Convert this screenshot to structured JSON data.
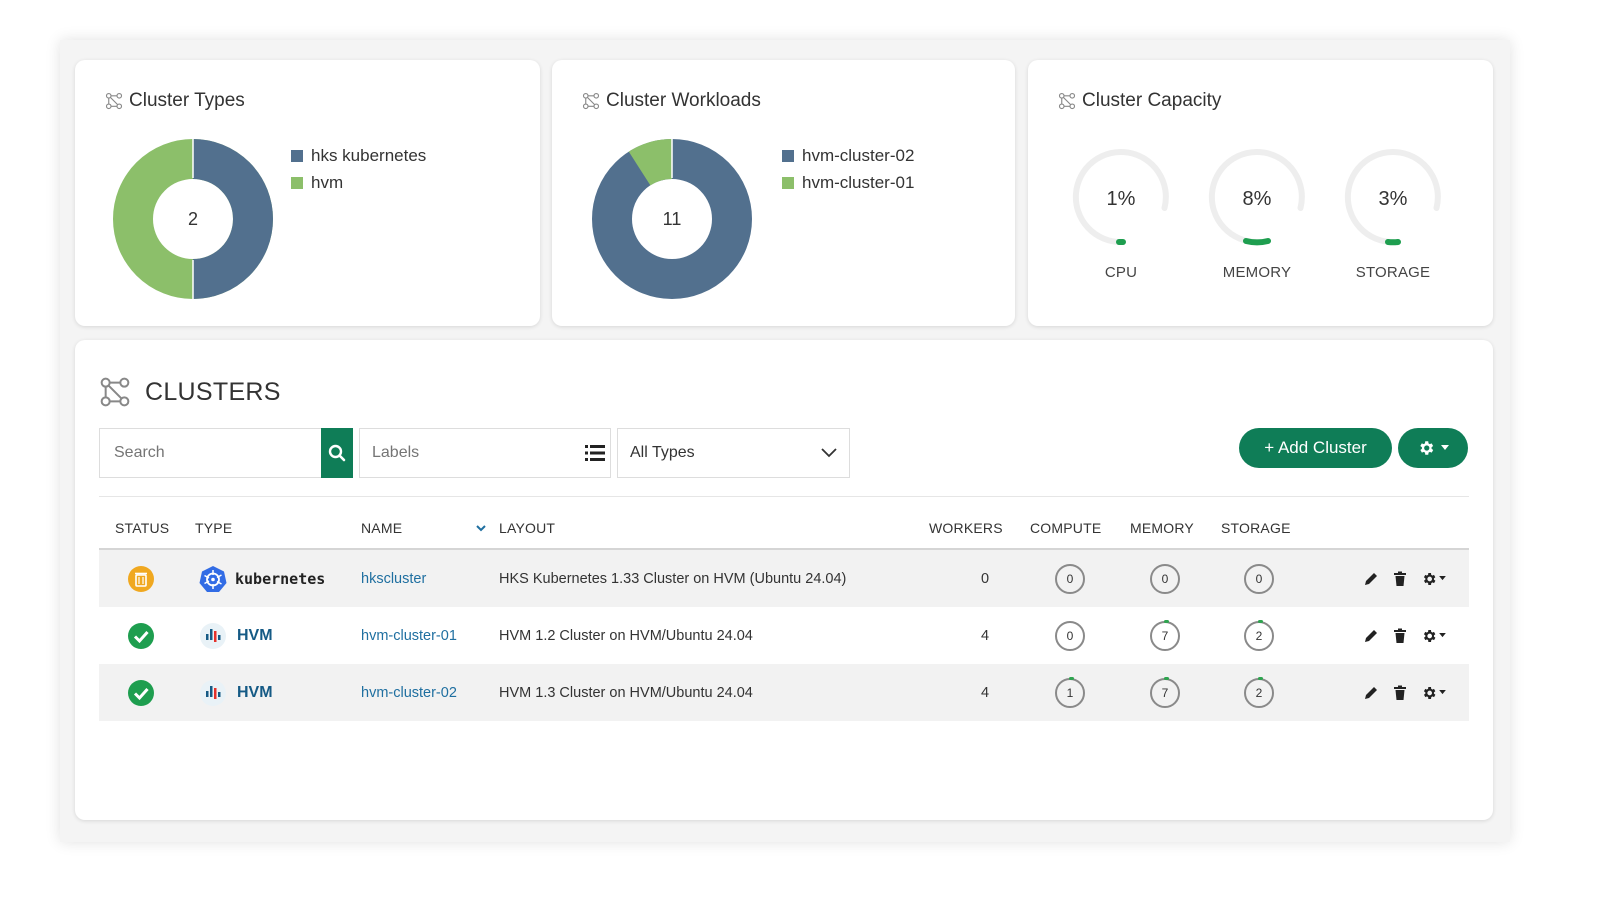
{
  "cards": {
    "types": {
      "title": "Cluster Types",
      "center_value": "2",
      "legend": [
        {
          "label": "hks kubernetes",
          "color": "#52708e"
        },
        {
          "label": "hvm",
          "color": "#8cbf6a"
        }
      ]
    },
    "workloads": {
      "title": "Cluster Workloads",
      "center_value": "11",
      "legend": [
        {
          "label": "hvm-cluster-02",
          "color": "#52708e"
        },
        {
          "label": "hvm-cluster-01",
          "color": "#8cbf6a"
        }
      ]
    },
    "capacity": {
      "title": "Cluster Capacity",
      "gauges": [
        {
          "value": "1%",
          "label": "CPU",
          "fraction": 0.01
        },
        {
          "value": "8%",
          "label": "MEMORY",
          "fraction": 0.08
        },
        {
          "value": "3%",
          "label": "STORAGE",
          "fraction": 0.03
        }
      ]
    }
  },
  "chart_data": [
    {
      "type": "pie",
      "categories": [
        "hks kubernetes",
        "hvm"
      ],
      "values": [
        1,
        1
      ],
      "colors": [
        "#52708e",
        "#8cbf6a"
      ]
    },
    {
      "type": "pie",
      "categories": [
        "hvm-cluster-02",
        "hvm-cluster-01"
      ],
      "values": [
        10,
        1
      ],
      "colors": [
        "#52708e",
        "#8cbf6a"
      ]
    }
  ],
  "clusters": {
    "title": "CLUSTERS",
    "search_placeholder": "Search",
    "labels_placeholder": "Labels",
    "type_filter": "All Types",
    "add_button": "+ Add Cluster",
    "columns": {
      "status": "STATUS",
      "type": "TYPE",
      "name": "NAME",
      "layout": "LAYOUT",
      "workers": "WORKERS",
      "compute": "COMPUTE",
      "memory": "MEMORY",
      "storage": "STORAGE"
    },
    "rows": [
      {
        "status": "pending",
        "type": "kubernetes",
        "name": "hkscluster",
        "layout": "HKS Kubernetes 1.33 Cluster on HVM (Ubuntu 24.04)",
        "workers": "0",
        "compute": "0",
        "memory": "0",
        "storage": "0"
      },
      {
        "status": "ok",
        "type": "HVM",
        "name": "hvm-cluster-01",
        "layout": "HVM 1.2 Cluster on HVM/Ubuntu 24.04",
        "workers": "4",
        "compute": "0",
        "memory": "7",
        "storage": "2"
      },
      {
        "status": "ok",
        "type": "HVM",
        "name": "hvm-cluster-02",
        "layout": "HVM 1.3 Cluster on HVM/Ubuntu 24.04",
        "workers": "4",
        "compute": "1",
        "memory": "7",
        "storage": "2"
      }
    ]
  },
  "colors": {
    "accent": "#0f7d57",
    "donut_primary": "#52708e",
    "donut_secondary": "#8cbf6a",
    "warning": "#f0a820",
    "success": "#1e9e4f"
  }
}
